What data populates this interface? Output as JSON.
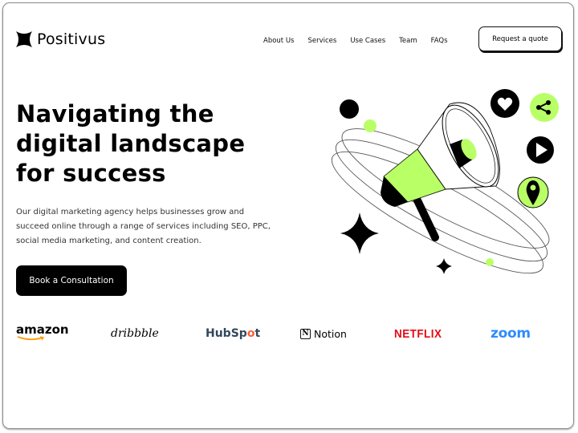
{
  "header": {
    "logo_text": "Positivus",
    "nav": [
      "About Us",
      "Services",
      "Use Cases",
      "Team",
      "FAQs"
    ],
    "quote_button": "Request a quote"
  },
  "hero": {
    "title_lines": [
      "Navigating the",
      "digital landscape",
      "for success"
    ],
    "description_lines": [
      "Our digital marketing agency helps businesses grow and",
      "succeed online through a range of services including SEO, PPC,",
      "social media marketing, and content creation."
    ],
    "cta_button": "Book a Consultation"
  },
  "illustration": {
    "icons": [
      "heart-icon",
      "share-icon",
      "play-icon",
      "location-pin-icon"
    ],
    "accent_color": "#b9ff66"
  },
  "brands": {
    "amazon": "amazon",
    "dribbble": "dribbble",
    "hubspot_pre": "HubSp",
    "hubspot_o": "o",
    "hubspot_post": "t",
    "notion_mark": "N",
    "notion": "Notion",
    "netflix": "NETFLIX",
    "zoom": "zoom"
  },
  "colors": {
    "accent": "#b9ff66",
    "dark": "#000000",
    "netflix": "#e50914",
    "zoom": "#2d8cff",
    "hubspot": "#33475b",
    "hubspot_orange": "#ff5c35",
    "amazon_smile": "#ff9900"
  }
}
